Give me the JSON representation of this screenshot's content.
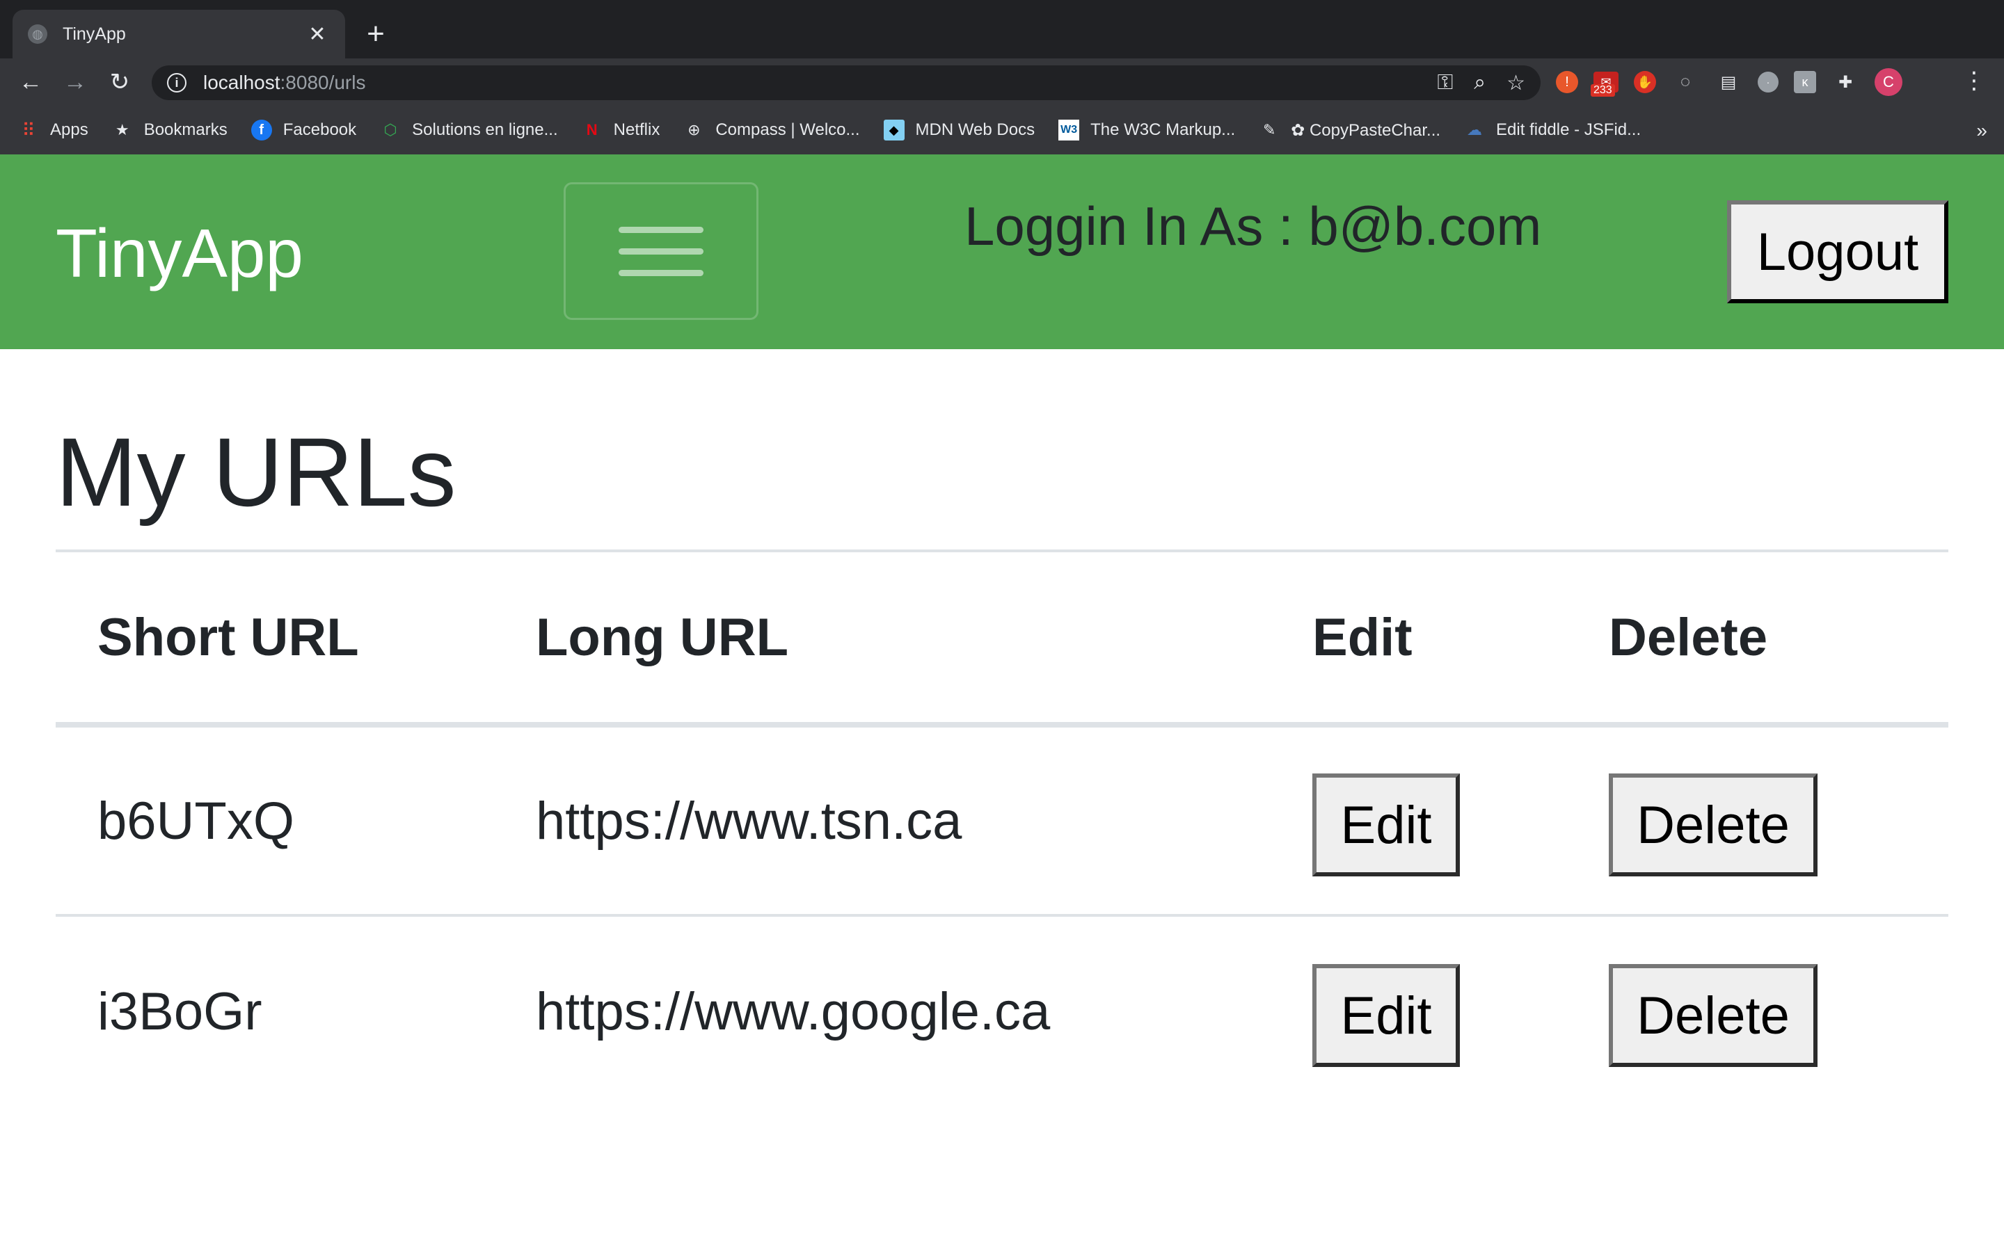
{
  "browser": {
    "tab_title": "TinyApp",
    "url_host": "localhost",
    "url_path": ":8080/urls",
    "bookmarks": [
      {
        "label": "Apps",
        "icon": "apps-grid-icon"
      },
      {
        "label": "Bookmarks",
        "icon": "star-icon"
      },
      {
        "label": "Facebook",
        "icon": "facebook-icon"
      },
      {
        "label": "Solutions en ligne...",
        "icon": "hexagon-icon"
      },
      {
        "label": "Netflix",
        "icon": "netflix-icon"
      },
      {
        "label": "Compass | Welco...",
        "icon": "compass-icon"
      },
      {
        "label": "MDN Web Docs",
        "icon": "mdn-icon"
      },
      {
        "label": "The W3C Markup...",
        "icon": "w3c-icon"
      },
      {
        "label": "✿ CopyPasteChar...",
        "icon": "copypaste-icon"
      },
      {
        "label": "Edit fiddle - JSFid...",
        "icon": "jsfiddle-icon"
      }
    ],
    "extension_badge": "233",
    "profile_initial": "C"
  },
  "navbar": {
    "brand": "TinyApp",
    "login_text": "Loggin In As : b@b.com",
    "logout_label": "Logout",
    "background_color": "#51a651"
  },
  "main": {
    "title": "My URLs",
    "columns": [
      "Short URL",
      "Long URL",
      "Edit",
      "Delete"
    ],
    "rows": [
      {
        "short_url": "b6UTxQ",
        "long_url": "https://www.tsn.ca",
        "edit_label": "Edit",
        "delete_label": "Delete"
      },
      {
        "short_url": "i3BoGr",
        "long_url": "https://www.google.ca",
        "edit_label": "Edit",
        "delete_label": "Delete"
      }
    ]
  }
}
